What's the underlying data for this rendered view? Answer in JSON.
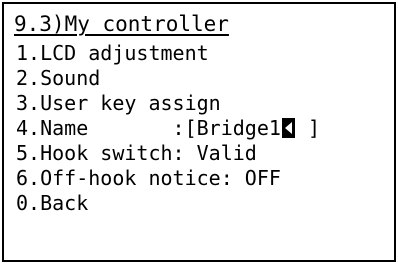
{
  "title": "9.3)My controller",
  "menu": [
    {
      "label": "1.LCD adjustment"
    },
    {
      "label": "2.Sound"
    },
    {
      "label": "3.User key assign"
    },
    {
      "label_pre": "4.Name       :[Bridge1",
      "label_post": " ]"
    },
    {
      "label": "5.Hook switch: Valid"
    },
    {
      "label": "6.Off-hook notice: OFF"
    },
    {
      "label": "0.Back"
    }
  ]
}
